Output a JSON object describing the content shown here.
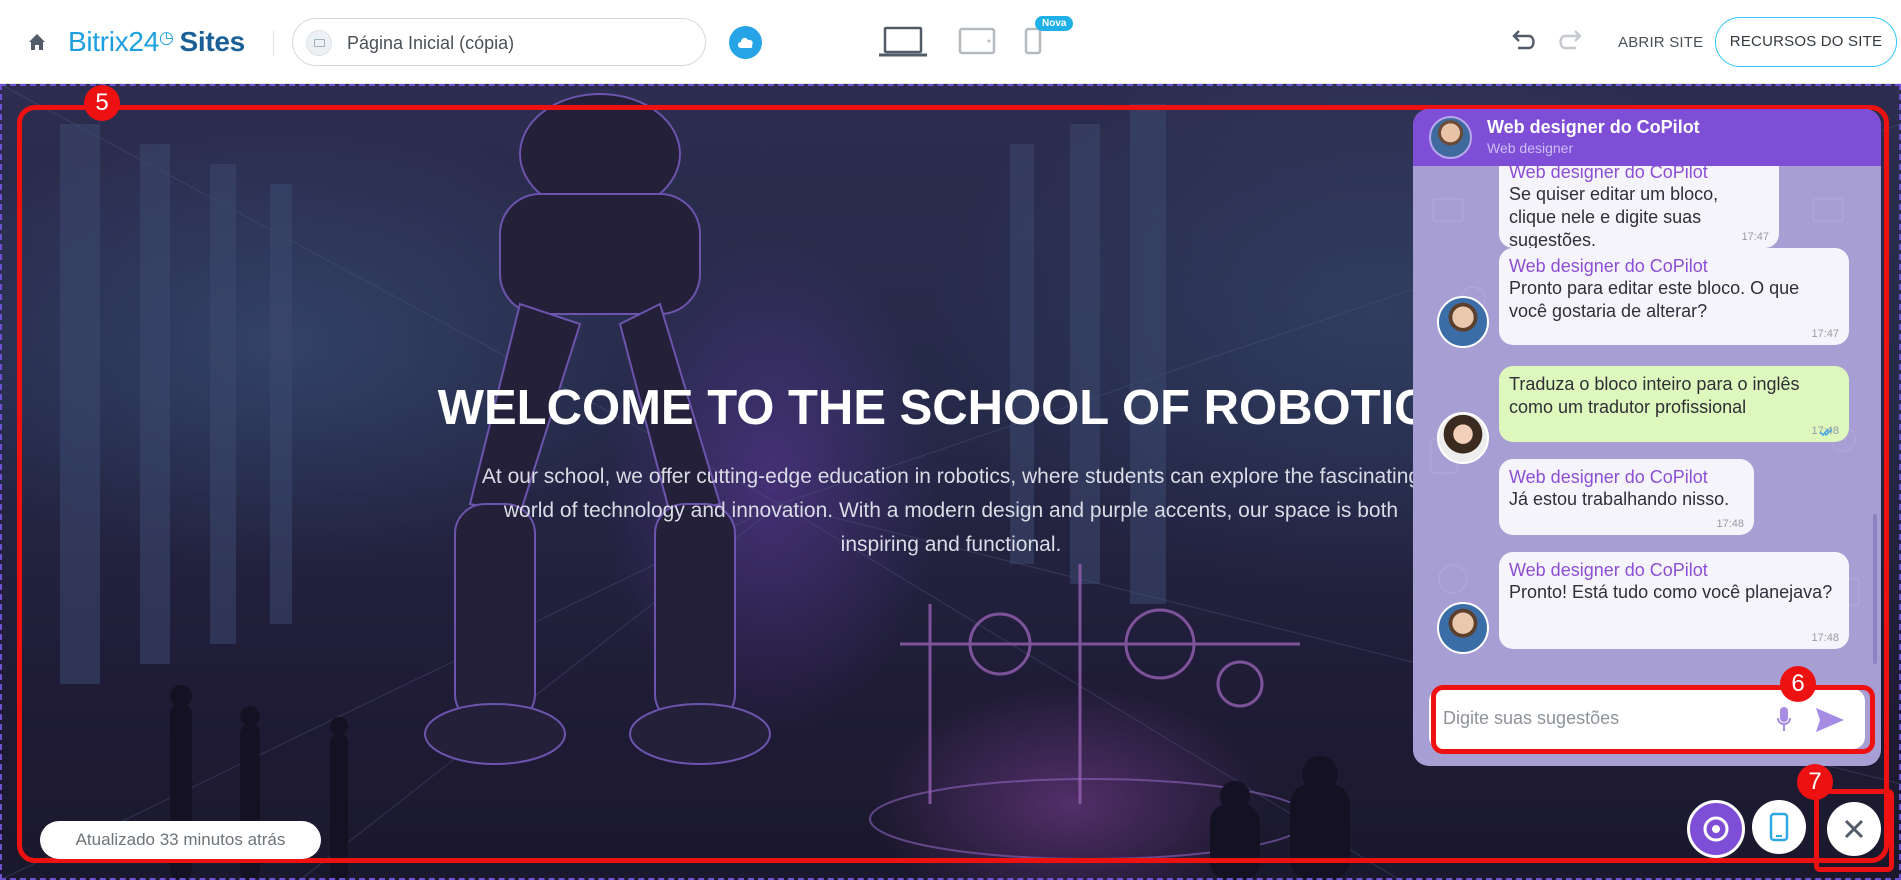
{
  "topbar": {
    "logo_main": "Bitrix24",
    "logo_clock": "◷",
    "logo_suffix": "Sites",
    "page_name": "Página Inicial (cópia)",
    "badge_new": "Nova",
    "open_site": "ABRIR SITE",
    "site_resources": "RECURSOS DO SITE"
  },
  "hero": {
    "title": "WELCOME TO THE SCHOOL OF ROBOTICS",
    "text": "At our school, we offer cutting-edge education in robotics, where students can explore the fascinating world of technology and innovation. With a modern design and purple accents, our space is both inspiring and functional.",
    "updated": "Atualizado 33 minutos atrás"
  },
  "annotations": {
    "block": "5",
    "input": "6",
    "close": "7"
  },
  "chat": {
    "name": "Web designer do CoPilot",
    "role": "Web designer",
    "input_placeholder": "Digite suas sugestões",
    "messages": [
      {
        "author": "Web designer do CoPilot",
        "text": "Se quiser editar um bloco, clique nele e digite suas sugestões.",
        "time": "17:47"
      },
      {
        "author": "Web designer do CoPilot",
        "text": "Pronto para editar este bloco. O que você gostaria de alterar?",
        "time": "17:47"
      },
      {
        "author": "",
        "text": "Traduza o bloco inteiro para o inglês como um tradutor profissional",
        "time": "17:48"
      },
      {
        "author": "Web designer do CoPilot",
        "text": "Já estou trabalhando nisso.",
        "time": "17:48"
      },
      {
        "author": "Web designer do CoPilot",
        "text": "Pronto! Está tudo como você planejava?",
        "time": "17:48"
      }
    ]
  },
  "colors": {
    "accent_blue": "#2fc6f6",
    "copilot_purple": "#7e4fd6",
    "annotation_red": "#ee1111",
    "user_bubble": "#ddf7bd"
  }
}
